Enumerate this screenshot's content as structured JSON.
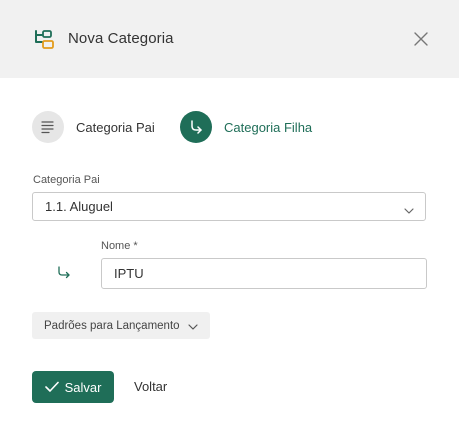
{
  "header": {
    "title": "Nova Categoria",
    "icon": "category-tree-icon"
  },
  "segments": [
    {
      "label": "Categoria Pai",
      "icon": "list-lines-icon",
      "selected": false
    },
    {
      "label": "Categoria Filha",
      "icon": "sub-arrow-icon",
      "selected": true
    }
  ],
  "form": {
    "parent": {
      "label": "Categoria Pai",
      "value": "1.1. Aluguel"
    },
    "name": {
      "label": "Nome *",
      "value": "IPTU"
    },
    "defaults_button": "Padrões para Lançamento"
  },
  "actions": {
    "save": "Salvar",
    "back": "Voltar"
  },
  "colors": {
    "accent": "#1f6e58",
    "header_bg": "#f1f1f1",
    "icon_orange": "#e39b1b"
  }
}
